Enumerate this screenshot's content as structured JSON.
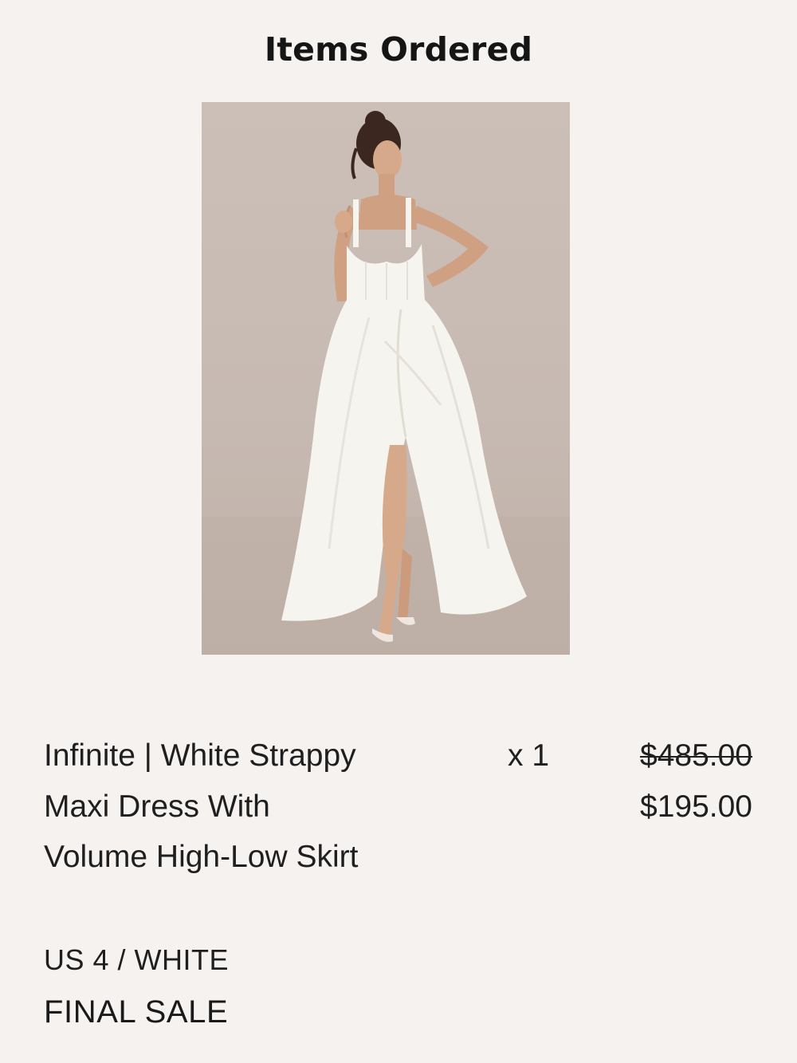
{
  "order": {
    "section_title": "Items Ordered",
    "item": {
      "name": "Infinite | White Strappy Maxi Dress With Volume High-Low Skirt",
      "variant": "US 4 / WHITE",
      "note": "FINAL SALE",
      "quantity": "x 1",
      "original_price": "$485.00",
      "sale_price": "$195.00",
      "image_alt": "Woman wearing white strappy maxi dress with volume high-low skirt"
    }
  },
  "colors": {
    "background": "#f5f2f0",
    "text": "#1f1f1f",
    "photo_backdrop": "#c7bab2",
    "dress": "#f6f4ef"
  }
}
